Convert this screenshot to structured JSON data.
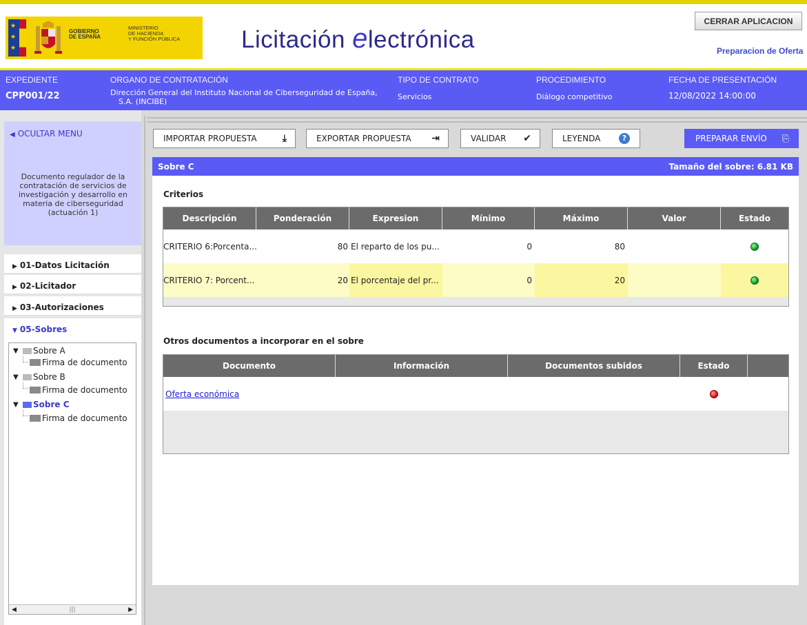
{
  "header": {
    "gov_line1": "GOBIERNO",
    "gov_line2": "DE ESPAÑA",
    "ministry_line1": "MINISTERIO",
    "ministry_line2": "DE HACIENDA",
    "ministry_line3": "Y FUNCIÓN PÚBLICA",
    "title_prefix": "Licitación ",
    "title_e": "e",
    "title_suffix": "lectrónica",
    "close_button": "CERRAR APLICACION",
    "mode": "Preparacion de Oferta"
  },
  "info": {
    "expediente_label": "EXPEDIENTE",
    "expediente_value": "CPP001/22",
    "organo_label": "ORGANO DE CONTRATACIÓN",
    "organo_value_line1": "Dirección General del Instituto Nacional de Ciberseguridad de España,",
    "organo_value_line2": "S.A. (INCIBE)",
    "tipo_label": "TIPO DE CONTRATO",
    "tipo_value": "Servicios",
    "procedimiento_label": "PROCEDIMIENTO",
    "procedimiento_value": "Diálogo competitivo",
    "fecha_label": "FECHA DE PRESENTACIÓN",
    "fecha_value": "12/08/2022 14:00:00"
  },
  "sidebar": {
    "hide_menu": "OCULTAR MENU",
    "description": "Documento regulador de la contratación de servicios de investigación y desarrollo en materia de ciberseguridad (actuación 1)",
    "items": [
      {
        "label": "01-Datos Licitación",
        "expanded": false
      },
      {
        "label": "02-Licitador",
        "expanded": false
      },
      {
        "label": "03-Autorizaciones",
        "expanded": false
      },
      {
        "label": "05-Sobres",
        "expanded": true
      }
    ],
    "tree": [
      {
        "label": "Sobre A",
        "child": "Firma de documento"
      },
      {
        "label": "Sobre B",
        "child": "Firma de documento"
      },
      {
        "label": "Sobre C",
        "child": "Firma de documento"
      }
    ]
  },
  "toolbar": {
    "import": "IMPORTAR PROPUESTA",
    "export": "EXPORTAR PROPUESTA",
    "validate": "VALIDAR",
    "legend": "LEYENDA",
    "send": "PREPARAR ENVÍO"
  },
  "sobre": {
    "title": "Sobre C",
    "size": "Tamaño del sobre: 6.81 KB",
    "criterios_title": "Criterios",
    "criterios_columns": [
      "Descripción",
      "Ponderación",
      "Expresion",
      "Mínimo",
      "Máximo",
      "Valor",
      "Estado"
    ],
    "criterios_rows": [
      {
        "descripcion": "CRITERIO 6:Porcenta...",
        "ponderacion": "80",
        "expresion": "El reparto de los pu...",
        "minimo": "0",
        "maximo": "80",
        "valor": "",
        "estado": "green"
      },
      {
        "descripcion": "CRITERIO 7: Porcent...",
        "ponderacion": "20",
        "expresion": "El porcentaje del pr...",
        "minimo": "0",
        "maximo": "20",
        "valor": "",
        "estado": "green"
      }
    ],
    "otros_title": "Otros documentos a incorporar en el sobre",
    "otros_columns": [
      "Documento",
      "Información",
      "Documentos subidos",
      "Estado"
    ],
    "otros_rows": [
      {
        "documento": "Oferta económica",
        "informacion": "",
        "subidos": "",
        "estado": "red"
      }
    ]
  },
  "colors": {
    "accent": "#5a5af4",
    "header_yellow": "#e2d400",
    "logo_yellow": "#f3d400",
    "row_highlight": "#fdfbc6"
  }
}
